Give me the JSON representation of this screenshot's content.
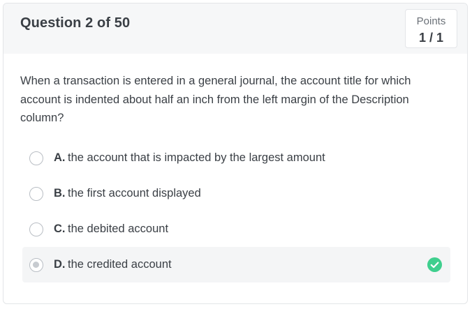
{
  "header": {
    "question_counter": "Question 2 of 50",
    "points_label": "Points",
    "points_value": "1 / 1"
  },
  "question": {
    "text": "When a transaction is entered in a general journal, the account title for which account is indented about half an inch from the left margin of the Description column?"
  },
  "options": [
    {
      "letter": "A.",
      "text": "the account that is impacted by the largest amount",
      "selected": false
    },
    {
      "letter": "B.",
      "text": "the first account displayed",
      "selected": false
    },
    {
      "letter": "C.",
      "text": "the debited account",
      "selected": false
    },
    {
      "letter": "D.",
      "text": "the credited account",
      "selected": true,
      "result_icon": "check-circle-icon"
    }
  ],
  "colors": {
    "correct": "#3fcf8e",
    "header_bg": "#f6f7f8",
    "selected_bg": "#f4f5f6",
    "text": "#3a3f45"
  }
}
